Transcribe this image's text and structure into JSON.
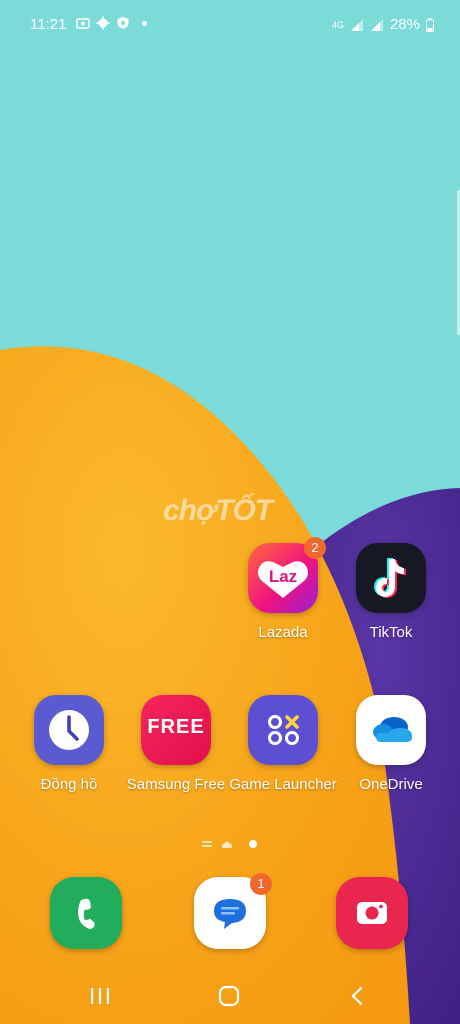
{
  "status_bar": {
    "time": "11:21",
    "network": "4G",
    "battery": "28%"
  },
  "watermark": "chợTỐT",
  "home_apps": [
    {
      "label": "Lazada",
      "badge": "2",
      "icon": "lazada-icon"
    },
    {
      "label": "TikTok",
      "icon": "tiktok-icon"
    },
    {
      "label": "Đồng hồ",
      "icon": "clock-icon"
    },
    {
      "label": "Samsung Free",
      "icon": "samsung-free-icon"
    },
    {
      "label": "Game Launcher",
      "icon": "game-launcher-icon"
    },
    {
      "label": "OneDrive",
      "icon": "onedrive-icon"
    }
  ],
  "lazada_text": "Laz",
  "free_text": "FREE",
  "dock": [
    {
      "name": "phone",
      "icon": "phone-icon"
    },
    {
      "name": "messages",
      "badge": "1",
      "icon": "messages-icon"
    },
    {
      "name": "camera",
      "icon": "camera-icon"
    }
  ],
  "colors": {
    "sky": "#7adbd8",
    "orange": "#f7a81c",
    "purple": "#4a2a8e",
    "badge": "#f2672e"
  }
}
